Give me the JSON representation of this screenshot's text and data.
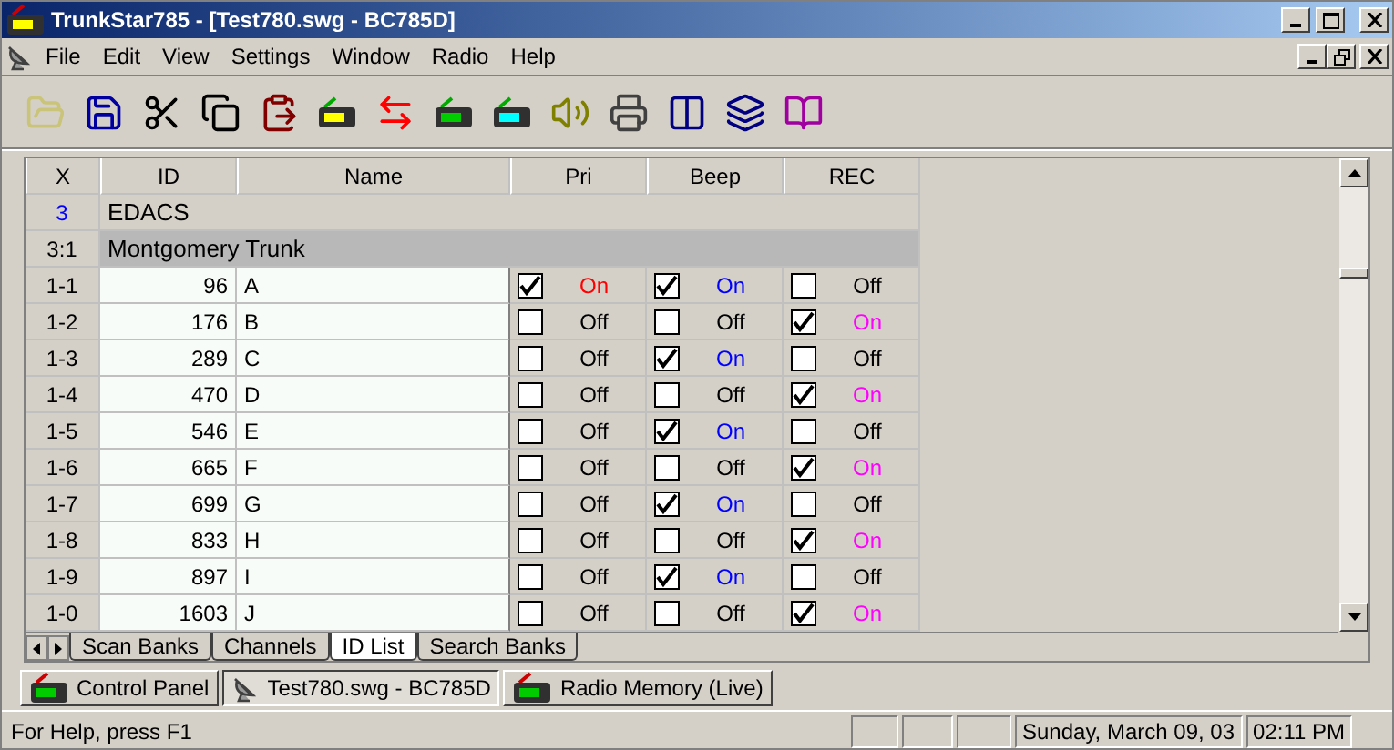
{
  "window": {
    "title": "TrunkStar785 - [Test780.swg - BC785D]"
  },
  "menu": [
    "File",
    "Edit",
    "View",
    "Settings",
    "Window",
    "Radio",
    "Help"
  ],
  "table": {
    "columns": [
      "X",
      "ID",
      "Name"
    ],
    "check_columns": [
      {
        "label": "Pri",
        "color": "#ff0000"
      },
      {
        "label": "Beep",
        "color": "#0000ff"
      },
      {
        "label": "REC",
        "color": "#ff00ff"
      }
    ],
    "rows": [
      {
        "kind": "system",
        "slot": "3",
        "label": "EDACS"
      },
      {
        "kind": "group",
        "slot": "3:1",
        "label": "Montgomery Trunk"
      },
      {
        "kind": "id",
        "slot": "1-1",
        "id": "96",
        "name": "A",
        "flags": [
          {
            "checked": true,
            "text": "On"
          },
          {
            "checked": true,
            "text": "On"
          },
          {
            "checked": false,
            "text": "Off"
          }
        ]
      },
      {
        "kind": "id",
        "slot": "1-2",
        "id": "176",
        "name": "B",
        "flags": [
          {
            "checked": false,
            "text": "Off"
          },
          {
            "checked": false,
            "text": "Off"
          },
          {
            "checked": true,
            "text": "On"
          }
        ]
      },
      {
        "kind": "id",
        "slot": "1-3",
        "id": "289",
        "name": "C",
        "flags": [
          {
            "checked": false,
            "text": "Off"
          },
          {
            "checked": true,
            "text": "On"
          },
          {
            "checked": false,
            "text": "Off"
          }
        ]
      },
      {
        "kind": "id",
        "slot": "1-4",
        "id": "470",
        "name": "D",
        "flags": [
          {
            "checked": false,
            "text": "Off"
          },
          {
            "checked": false,
            "text": "Off"
          },
          {
            "checked": true,
            "text": "On"
          }
        ]
      },
      {
        "kind": "id",
        "slot": "1-5",
        "id": "546",
        "name": "E",
        "flags": [
          {
            "checked": false,
            "text": "Off"
          },
          {
            "checked": true,
            "text": "On"
          },
          {
            "checked": false,
            "text": "Off"
          }
        ]
      },
      {
        "kind": "id",
        "slot": "1-6",
        "id": "665",
        "name": "F",
        "flags": [
          {
            "checked": false,
            "text": "Off"
          },
          {
            "checked": false,
            "text": "Off"
          },
          {
            "checked": true,
            "text": "On"
          }
        ]
      },
      {
        "kind": "id",
        "slot": "1-7",
        "id": "699",
        "name": "G",
        "flags": [
          {
            "checked": false,
            "text": "Off"
          },
          {
            "checked": true,
            "text": "On"
          },
          {
            "checked": false,
            "text": "Off"
          }
        ]
      },
      {
        "kind": "id",
        "slot": "1-8",
        "id": "833",
        "name": "H",
        "flags": [
          {
            "checked": false,
            "text": "Off"
          },
          {
            "checked": false,
            "text": "Off"
          },
          {
            "checked": true,
            "text": "On"
          }
        ]
      },
      {
        "kind": "id",
        "slot": "1-9",
        "id": "897",
        "name": "I",
        "flags": [
          {
            "checked": false,
            "text": "Off"
          },
          {
            "checked": true,
            "text": "On"
          },
          {
            "checked": false,
            "text": "Off"
          }
        ]
      },
      {
        "kind": "id",
        "slot": "1-0",
        "id": "1603",
        "name": "J",
        "flags": [
          {
            "checked": false,
            "text": "Off"
          },
          {
            "checked": false,
            "text": "Off"
          },
          {
            "checked": true,
            "text": "On"
          }
        ]
      }
    ]
  },
  "sheet_tabs": [
    {
      "label": "Scan Banks",
      "selected": false
    },
    {
      "label": "Channels",
      "selected": false
    },
    {
      "label": "ID List",
      "selected": true
    },
    {
      "label": "Search Banks",
      "selected": false
    }
  ],
  "window_tabs": [
    {
      "label": "Control Panel",
      "selected": false,
      "kind": "radio"
    },
    {
      "label": "Test780.swg - BC785D",
      "selected": true,
      "kind": "dish"
    },
    {
      "label": "Radio Memory (Live)",
      "selected": false,
      "kind": "radio"
    }
  ],
  "status_bar": {
    "help": "For Help, press F1",
    "date": "Sunday, March 09, 03",
    "time": "02:11 PM"
  }
}
